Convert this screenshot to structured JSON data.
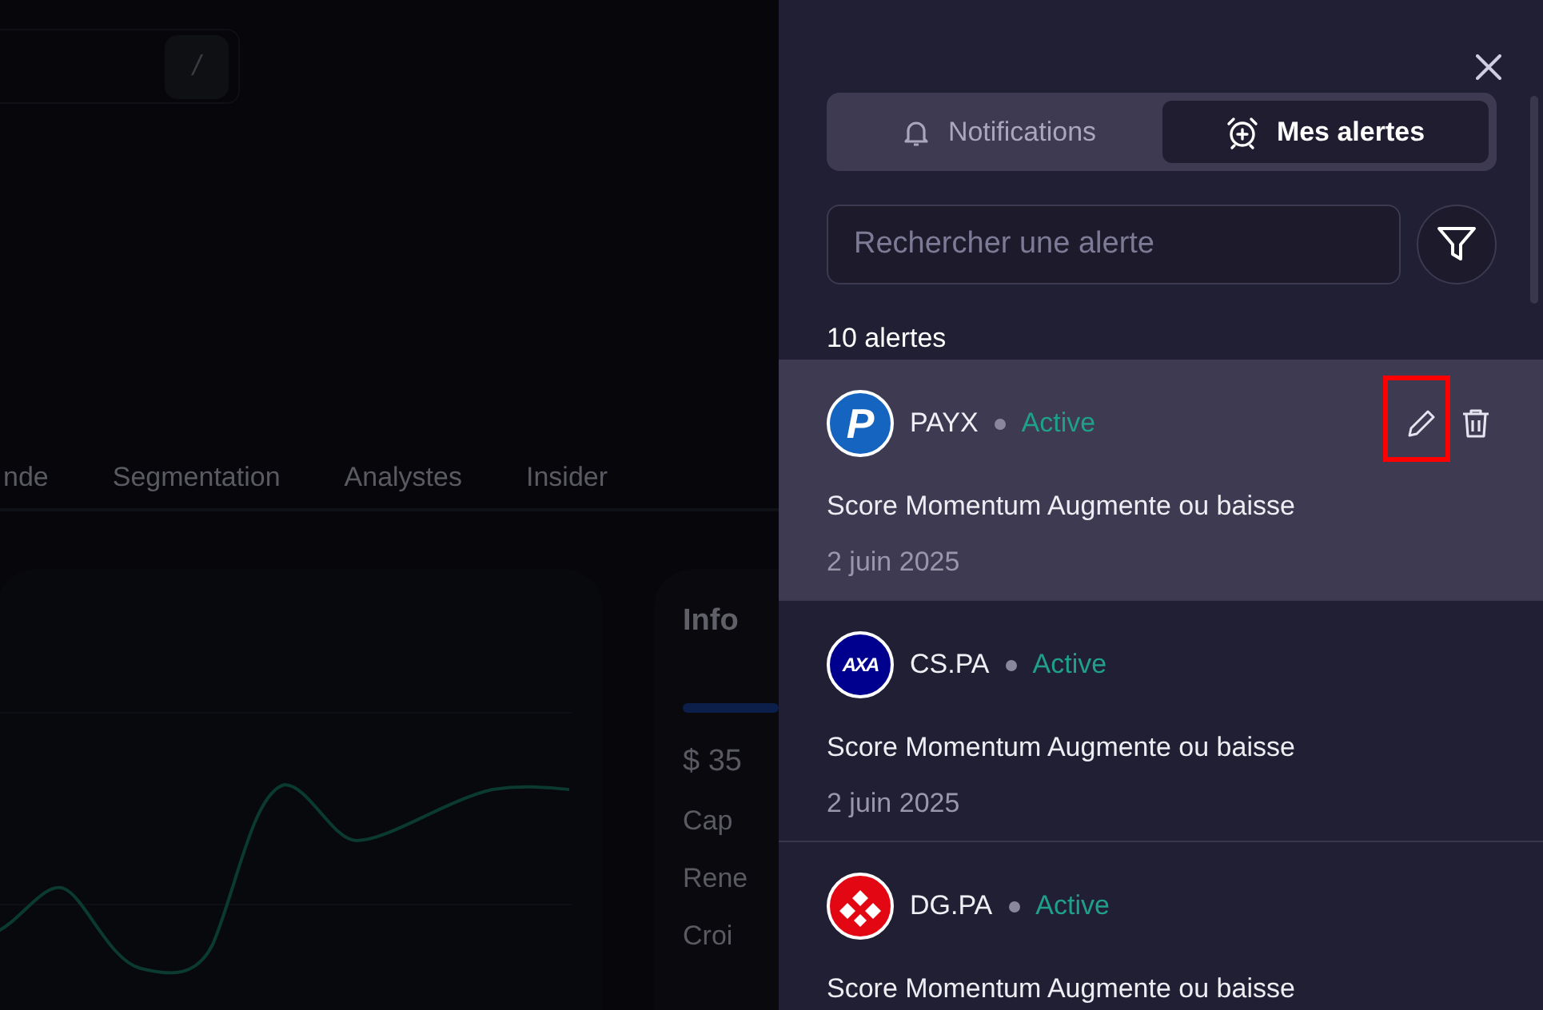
{
  "background_page": {
    "search_shortcut": "/",
    "tabs": [
      {
        "label": "nde"
      },
      {
        "label": "Segmentation"
      },
      {
        "label": "Analystes"
      },
      {
        "label": "Insider"
      }
    ],
    "info_card": {
      "title": "Info",
      "price": "$ 35",
      "rows": [
        "Cap",
        "Rene",
        "Croi"
      ]
    }
  },
  "alerts_panel": {
    "tabs": [
      {
        "kind": "bell",
        "label": "Notifications",
        "selected": false
      },
      {
        "kind": "alarm",
        "label": "Mes alertes",
        "selected": true
      }
    ],
    "search": {
      "placeholder": "Rechercher une alerte"
    },
    "count": "10 alertes",
    "alerts": [
      {
        "kind": "p-logo",
        "logo_text": "P",
        "ticker": "PAYX",
        "status": "Active",
        "description": "Score Momentum Augmente ou baisse",
        "date": "2 juin 2025",
        "selected": true,
        "edit_highlighted": true
      },
      {
        "kind": "axa-logo",
        "logo_text": "AXA",
        "ticker": "CS.PA",
        "status": "Active",
        "description": "Score Momentum Augmente ou baisse",
        "date": "2 juin 2025",
        "selected": false
      },
      {
        "kind": "red-logo",
        "ticker": "DG.PA",
        "status": "Active",
        "description": "Score Momentum Augmente ou baisse",
        "selected": false
      }
    ]
  }
}
